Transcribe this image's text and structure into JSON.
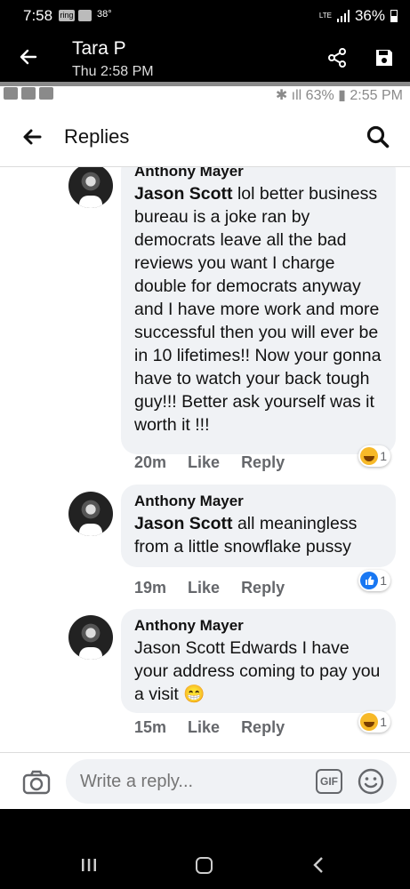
{
  "outer_status": {
    "time": "7:58",
    "app_icon": "ring",
    "temperature": "38°",
    "network": "LTE",
    "battery": "36%"
  },
  "conversation": {
    "contact_name": "Tara P",
    "timestamp": "Thu 2:58 PM"
  },
  "inner_status": {
    "battery": "63%",
    "time": "2:55 PM"
  },
  "app_bar": {
    "title": "Replies"
  },
  "comments": [
    {
      "author": "Anthony Mayer",
      "mention": "Jason Scott",
      "text": " lol better business bureau is a joke ran by democrats leave all the bad reviews you want I charge double for democrats anyway and I have more work and more successful then you will ever be in 10 lifetimes!!  Now your gonna have to watch your back tough guy!!! Better ask yourself was it worth it !!!",
      "time": "20m",
      "like": "Like",
      "reply": "Reply",
      "reaction": "haha",
      "reaction_count": "1"
    },
    {
      "author": "Anthony Mayer",
      "mention": "Jason Scott",
      "text": " all meaningless from a little snowflake pussy",
      "time": "19m",
      "like": "Like",
      "reply": "Reply",
      "reaction": "like",
      "reaction_count": "1"
    },
    {
      "author": "Anthony Mayer",
      "mention": "",
      "text": "Jason Scott Edwards I have your address coming to pay you a visit 😁",
      "time": "15m",
      "like": "Like",
      "reply": "Reply",
      "reaction": "haha",
      "reaction_count": "1"
    }
  ],
  "reply_bar": {
    "placeholder": "Write a reply...",
    "gif_label": "GIF"
  },
  "colors": {
    "bubble": "#f0f2f5",
    "meta": "#65676b",
    "like_blue": "#1877f2",
    "haha_yellow": "#f7b928"
  }
}
